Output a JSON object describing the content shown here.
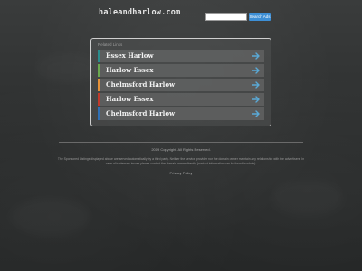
{
  "header": {
    "logo": "haleandharlow.com",
    "search_placeholder": "",
    "search_button": "Search Ads"
  },
  "related": {
    "heading": "Related Links",
    "links": [
      {
        "label": "Essex Harlow",
        "accent": "#2a8c8c"
      },
      {
        "label": "Harlow Essex",
        "accent": "#6aa84f"
      },
      {
        "label": "Chelmsford Harlow",
        "accent": "#e69138"
      },
      {
        "label": "Harlow Essex",
        "accent": "#c0392b"
      },
      {
        "label": "Chelmsford Harlow",
        "accent": "#2f6fb5"
      }
    ],
    "arrow_icon": "arrow-right-icon",
    "arrow_color": "#5aa9d6"
  },
  "footer": {
    "copyright": "2019 Copyright. All Rights Reserved.",
    "disclaimer": "The Sponsored Listings displayed above are served automatically by a third party. Neither the service provider nor the domain owner maintain any relationship with the advertisers. In case of trademark issues please contact the domain owner directly (contact information can be found in whois).",
    "privacy": "Privacy Policy"
  }
}
